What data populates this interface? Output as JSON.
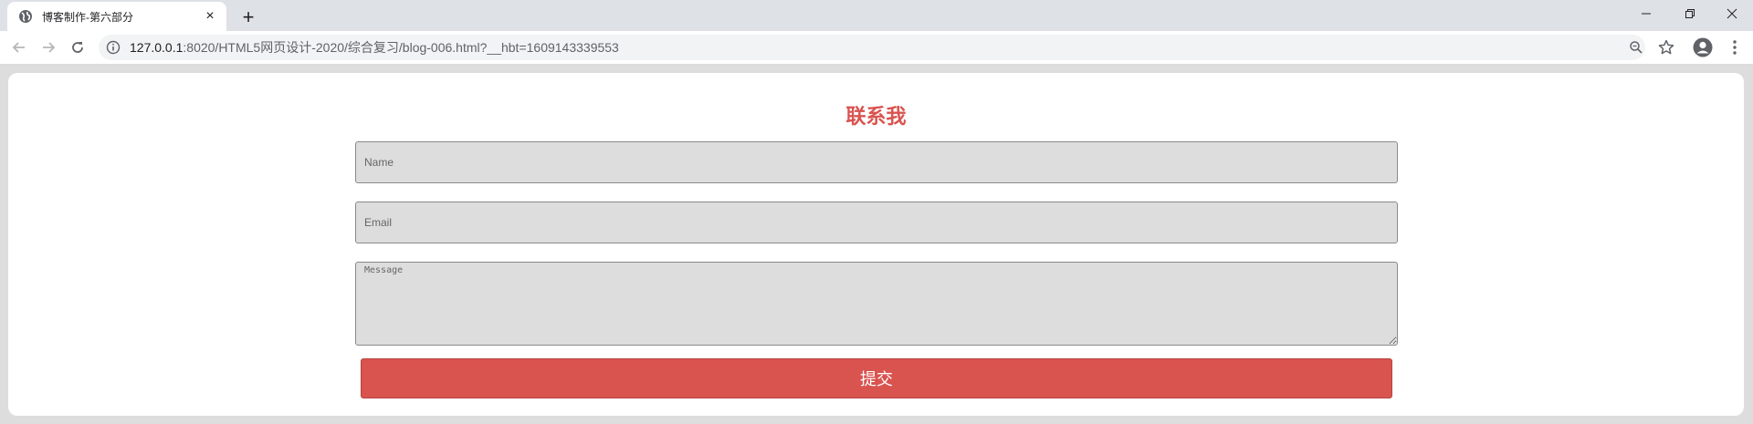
{
  "browser": {
    "tab": {
      "title": "博客制作-第六部分",
      "favicon": "globe-icon",
      "close": "×"
    },
    "new_tab": "+",
    "address": {
      "host": "127.0.0.1",
      "path": ":8020/HTML5网页设计-2020/综合复习/blog-006.html?__hbt=1609143339553"
    }
  },
  "page": {
    "title": "联系我",
    "form": {
      "name_placeholder": "Name",
      "email_placeholder": "Email",
      "message_placeholder": "Message",
      "submit_label": "提交"
    }
  },
  "colors": {
    "accent": "#d9534f",
    "field_bg": "#dddddd",
    "page_bg": "#dddddd",
    "chrome_bg": "#dee1e6"
  }
}
